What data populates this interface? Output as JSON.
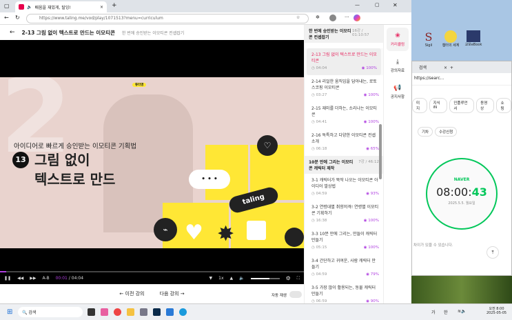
{
  "browser": {
    "tab_title": "배움을 재밌게, 탈잉!",
    "url": "https://www.taling.me/vod/play/1071513?menu=curriculum"
  },
  "header": {
    "title": "2-13 그림 없이 텍스트로 만드는 이모티콘",
    "subtitle": "한 번에 승인받는 이모티콘 컨셉잡기"
  },
  "video": {
    "badge": "튜터명",
    "subtitle": "아이디어로 빠르게 승인받는 이모티콘 기획법",
    "number": "13",
    "title_line1": "그림 없이",
    "title_line2": "텍스트로 만드",
    "big_number": "2",
    "brand": "taling",
    "bubble": "• • •"
  },
  "controls": {
    "ab": "A-B",
    "current": "00:01",
    "separator": "/",
    "duration": "04:04",
    "speed": "1x",
    "volume_percent": 65,
    "progress_percent": 0.4
  },
  "nav": {
    "prev": "← 이전 강의",
    "next": "다음 강의 →",
    "autoplay_label": "자동 재생",
    "autoplay": false
  },
  "curriculum": {
    "section1": {
      "title": "한 번에 승인받는 이모티콘 컨셉잡기",
      "count": "16강 / 01:10:57"
    },
    "section2": {
      "title": "10분 만에 그리는 이모티콘 캐릭터 제작",
      "count": "7강 / 46:12"
    },
    "items1": [
      {
        "title": "2-13 그림 없이 텍스트로 만드는 이모티콘",
        "time": "04:04",
        "progress": "100%",
        "current": true
      },
      {
        "title": "2-14 리얼한 움직임을 담아내는, 로토스코핑 이모티콘",
        "time": "03:27",
        "progress": "100%"
      },
      {
        "title": "2-15 재미를 더하는, 소리나는 이모티콘",
        "time": "04:41",
        "progress": "100%"
      },
      {
        "title": "2-16 독특하고 다양한 이모티콘 컨셉 소개",
        "time": "06:18",
        "progress": "65%"
      }
    ],
    "items2": [
      {
        "title": "3-1 캐릭터가 뚝딱 나오는 이모티콘 아이디어 발상법",
        "time": "04:59",
        "progress": "93%"
      },
      {
        "title": "3-2 연령대별 취향저격! 연령별 이모티콘 기획하기",
        "time": "16:38",
        "progress": "100%"
      },
      {
        "title": "3-3 10분 만에 그리는, 만들이 캐릭터 만들기",
        "time": "05:15",
        "progress": "100%"
      },
      {
        "title": "3-4 간단하고 귀여운, 사람 캐릭터 만들기",
        "time": "04:59",
        "progress": "79%"
      },
      {
        "title": "3-5 가장 많이 활용되는, 동물 캐릭터 만들기",
        "time": "06:59",
        "progress": "90%"
      }
    ]
  },
  "rail": [
    {
      "label": "커리큘럼"
    },
    {
      "label": "강의자료"
    },
    {
      "label": "공지사항"
    }
  ],
  "desktop": {
    "icons": [
      "Sigil",
      "챕터의 세계",
      "교보eBook"
    ]
  },
  "second_window": {
    "tab": "검색",
    "url": "https://searc...",
    "chips": [
      "미지",
      "지식iN",
      "인플루언서",
      "동영상",
      "쇼핑"
    ],
    "chips2": [
      "기차",
      "수강신청"
    ],
    "brand": "NAVER",
    "clock_main": "08:00:",
    "clock_sec": "43",
    "date": "2025.5.5. 월요일",
    "note": "차이가 있을 수 있습니다."
  },
  "taskbar": {
    "search": "검색",
    "ime1": "가",
    "ime2": "한",
    "time": "오전 8:00",
    "date": "2025-05-05"
  },
  "colors": {
    "accent": "#e6245e",
    "progress": "#b040e0",
    "naver": "#03c75a",
    "yellow": "#ffe735"
  }
}
